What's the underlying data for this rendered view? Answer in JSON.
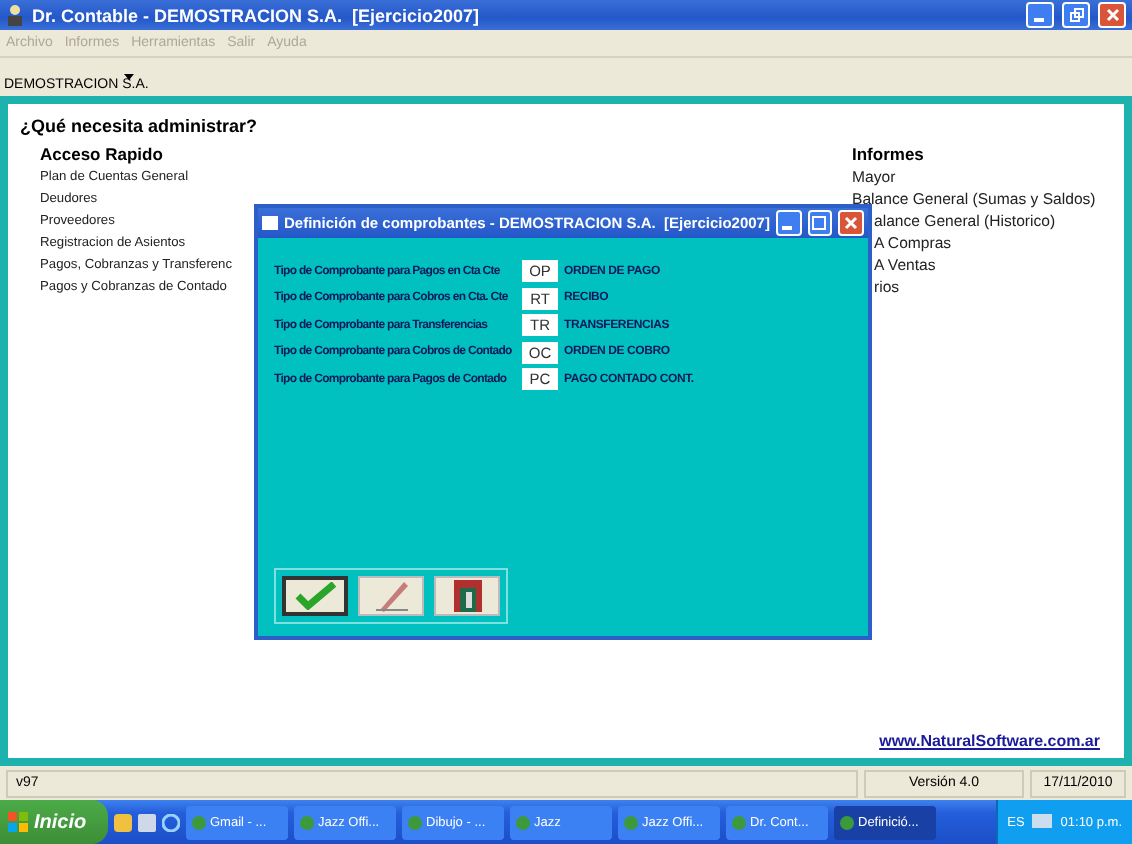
{
  "window": {
    "title": "Dr. Contable - DEMOSTRACION S.A.  [Ejercicio2007]"
  },
  "menu": [
    {
      "label": "Archivo",
      "disabled": true
    },
    {
      "label": "Informes",
      "disabled": true
    },
    {
      "label": "Herramientas",
      "disabled": true
    },
    {
      "label": "Salir",
      "disabled": true
    },
    {
      "label": "Ayuda",
      "disabled": true
    }
  ],
  "company_selector": {
    "value": "DEMOSTRACION S.A."
  },
  "content": {
    "heading": "¿Qué necesita administrar?",
    "quick_access": {
      "title": "Acceso Rapido",
      "items": [
        "Plan de Cuentas General",
        "Deudores",
        "Proveedores",
        "Registracion de Asientos",
        "Pagos, Cobranzas y Transferenc",
        "Pagos y Cobranzas de Contado"
      ]
    },
    "reports": {
      "title": "Informes",
      "items": [
        {
          "label": "Mayor",
          "kind": "full"
        },
        {
          "label": "Balance General (Sumas y Saldos)",
          "kind": "full"
        },
        {
          "label": "alance General (Historico)",
          "kind": "clipped"
        },
        {
          "label": "A Compras",
          "kind": "clipped"
        },
        {
          "label": "A Ventas",
          "kind": "clipped"
        },
        {
          "label": "rios",
          "kind": "clipped"
        }
      ]
    },
    "link": "www.NaturalSoftware.com.ar"
  },
  "dialog": {
    "title": "Definición de comprobantes - DEMOSTRACION S.A.  [Ejercicio2007]",
    "rows": [
      {
        "label": "Tipo de Comprobante para Pagos en Cta Cte",
        "code": "OP",
        "description": "ORDEN DE PAGO"
      },
      {
        "label": "Tipo de Comprobante para Cobros en Cta. Cte",
        "code": "RT",
        "description": "RECIBO"
      },
      {
        "label": "Tipo de Comprobante para Transferencias",
        "code": "TR",
        "description": "TRANSFERENCIAS"
      },
      {
        "label": "Tipo de Comprobante para Cobros de Contado",
        "code": "OC",
        "description": "ORDEN DE COBRO"
      },
      {
        "label": "Tipo de Comprobante para Pagos de Contado",
        "code": "PC",
        "description": "PAGO CONTADO CONT."
      }
    ],
    "buttons": [
      {
        "kind": "accept",
        "selected": true
      },
      {
        "kind": "edit",
        "selected": false
      },
      {
        "kind": "exit",
        "selected": false
      }
    ]
  },
  "status_bar": {
    "left": "v97",
    "version": "Versión 4.0",
    "date": "17/11/2010"
  },
  "taskbar": {
    "start": "Inicio",
    "tasks": [
      {
        "label": "Gmail - ...",
        "selected": false
      },
      {
        "label": "Jazz Offi...",
        "selected": false
      },
      {
        "label": "Dibujo - ...",
        "selected": false
      },
      {
        "label": "Jazz",
        "selected": false
      },
      {
        "label": "Jazz Offi...",
        "selected": false
      },
      {
        "label": "Dr. Cont...",
        "selected": false
      },
      {
        "label": "Definició...",
        "selected": true
      }
    ],
    "language": "ES",
    "clock": "01:10 p.m."
  }
}
